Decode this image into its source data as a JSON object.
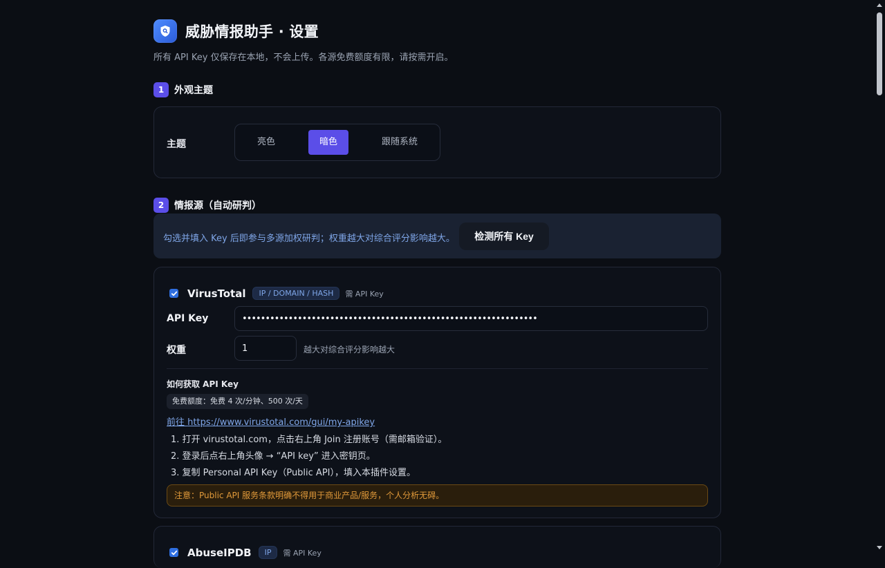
{
  "header": {
    "title": "威胁情报助手 · 设置",
    "subtitle": "所有 API Key 仅保存在本地，不会上传。各源免费额度有限，请按需开启。"
  },
  "sections": {
    "theme": {
      "num": "1",
      "title": "外观主题"
    },
    "sources": {
      "num": "2",
      "title": "情报源（自动研判）"
    }
  },
  "theme": {
    "label": "主题",
    "options": [
      "亮色",
      "暗色",
      "跟随系统"
    ],
    "selected": "暗色"
  },
  "info": {
    "text": "勾选并填入 Key 后即参与多源加权研判；权重越大对综合评分影响越大。",
    "check_button": "检测所有 Key"
  },
  "virustotal": {
    "enabled": true,
    "name": "VirusTotal",
    "tag": "IP / DOMAIN / HASH",
    "need": "需 API Key",
    "api_label": "API Key",
    "api_value": "••••••••••••••••••••••••••••••••••••••••••••••••••••••••••••••••",
    "weight_label": "权重",
    "weight_value": "1",
    "weight_hint": "越大对综合评分影响越大",
    "how_title": "如何获取 API Key",
    "quota": "免费额度：免费 4 次/分钟、500 次/天",
    "link_prefix": "前往 ",
    "link_url": "https://www.virustotal.com/gui/my-apikey",
    "steps": [
      "1. 打开 virustotal.com，点击右上角 Join 注册账号（需邮箱验证）。",
      "2. 登录后点右上角头像 → “API key” 进入密钥页。",
      "3. 复制 Personal API Key（Public API），填入本插件设置。"
    ],
    "warning": "注意：Public API 服务条款明确不得用于商业产品/服务，个人分析无碍。"
  },
  "abuseipdb": {
    "enabled": true,
    "name": "AbuseIPDB",
    "tag": "IP",
    "need": "需 API Key"
  },
  "colors": {
    "accent": "#5b4ee8",
    "link": "#7fa6e8",
    "warning": "#e29a3a",
    "background": "#0b0e14"
  }
}
